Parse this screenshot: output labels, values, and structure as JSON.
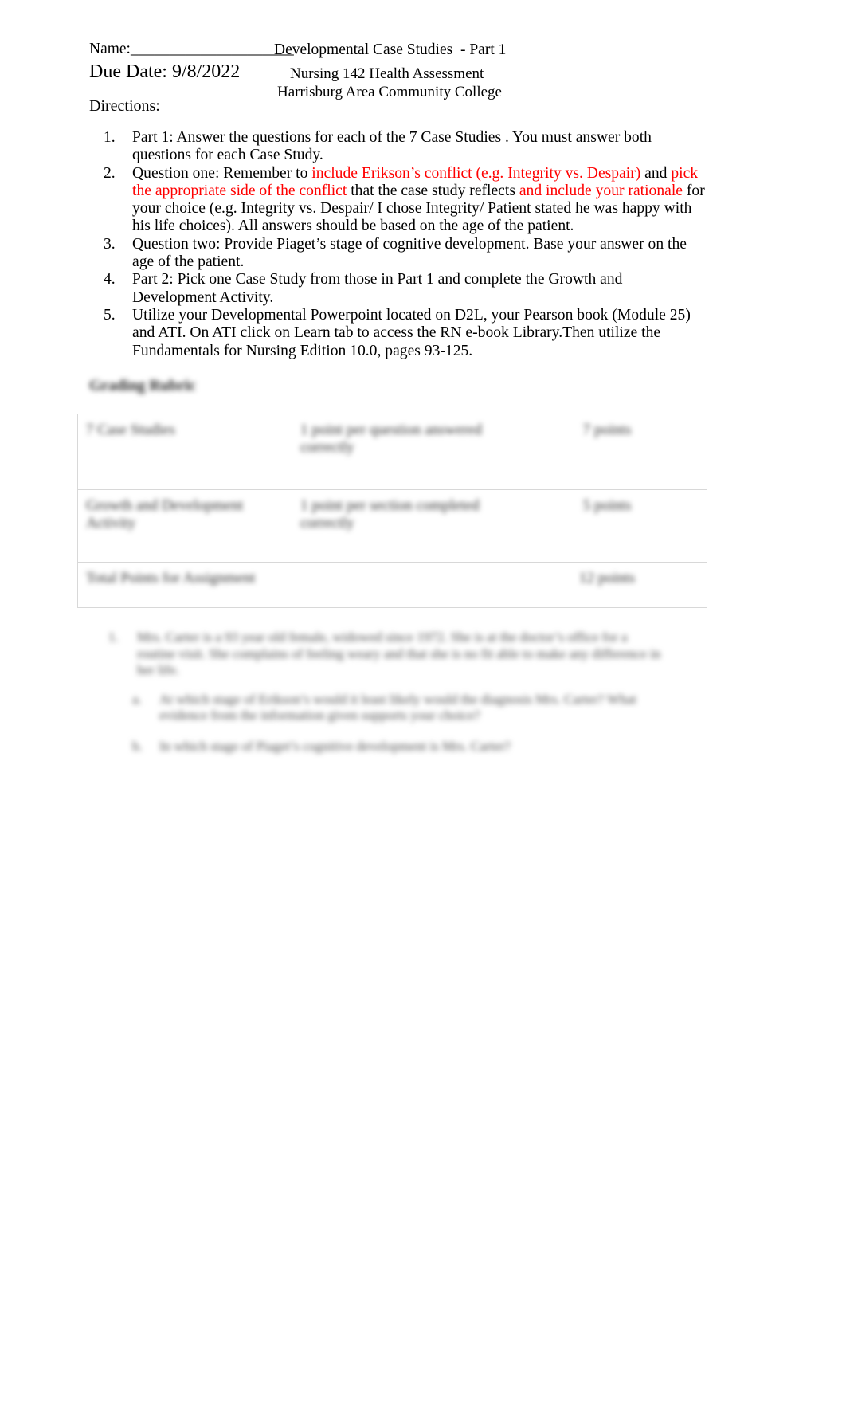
{
  "document": {
    "header": {
      "name_label": "Name:_____________________",
      "title": "Developmental Case Studies  - Part 1",
      "due_date": "Due Date: 9/8/2022",
      "course": "Nursing 142 Health Assessment",
      "college": "Harrisburg Area Community College"
    },
    "directions_label": "Directions:",
    "steps": [
      {
        "number": "1.",
        "segments": [
          {
            "text": "Part 1:  Answer the questions for each of the 7 Case Studies   .  You must answer both questions for each Case Study.",
            "color": "black"
          }
        ]
      },
      {
        "number": "2.",
        "segments": [
          {
            "text": "Question one:   Remember to ",
            "color": "black"
          },
          {
            "text": "include Erikson’s conflict (e.g. Integrity vs. Despair)",
            "color": "red"
          },
          {
            "text": " and ",
            "color": "black"
          },
          {
            "text": "pick the appropriate side of the conflict",
            "color": "red"
          },
          {
            "text": "   that the case study reflects  ",
            "color": "black"
          },
          {
            "text": "and include your rationale",
            "color": "red"
          },
          {
            "text": "  for your choice (e.g. Integrity vs. Despair/ I chose Integrity/ Patient stated he was happy with his life choices).  All answers should be based on the age   of the patient.",
            "color": "black"
          }
        ]
      },
      {
        "number": "3.",
        "segments": [
          {
            "text": "Question two:   Provide Piaget’s stage of cognitive development.    Base your answer on the age  of the patient.",
            "color": "black"
          }
        ]
      },
      {
        "number": "4.",
        "segments": [
          {
            "text": "Part 2:  Pick one Case Study from those in Part 1  and complete the Growth and Development Activity.",
            "color": "black"
          }
        ]
      },
      {
        "number": "5.",
        "segments": [
          {
            "text": "Utilize your Developmental Powerpoint located on D2L, your Pearson book (Module 25) and ATI.  On ATI click on Learn tab to access the RN e-book Library.Then utilize the Fundamentals for Nursing Edition 10.0, pages 93-125.",
            "color": "black"
          }
        ]
      }
    ],
    "rubric_heading": "Grading Rubric",
    "rubric_table": {
      "rows": [
        {
          "criteria": "7 Case Studies",
          "detail": "1  point per question answered correctly",
          "points": "7 points"
        },
        {
          "criteria": "Growth and Development Activity",
          "detail": "1  point per section completed correctly",
          "points": "5 points"
        },
        {
          "criteria": "Total Points for Assignment",
          "detail": "",
          "points": "12 points"
        }
      ]
    },
    "case_section": {
      "items": [
        {
          "marker": "1.",
          "text": "Mrs. Carter is a 93 year old female, widowed since 1972.  She is at the doctor’s office for a routine visit.  She complains of feeling weary and that she is no fit able to make any difference in her life."
        }
      ],
      "sub_items": [
        {
          "marker": "a.",
          "text": "At which stage of Erikson’s would it least likely would the diagnosis Mrs. Carter?  What evidence from the information given supports your choice?"
        },
        {
          "marker": "b.",
          "text": "In which stage of Piaget’s cognitive development is Mrs. Carter?"
        }
      ]
    }
  }
}
